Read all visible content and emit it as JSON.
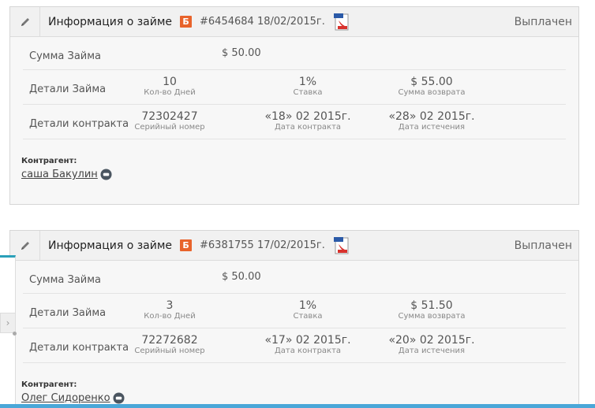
{
  "loans": [
    {
      "title": "Информация о займе",
      "badge": "Б",
      "ref": "#6454684 18/02/2015г.",
      "status": "Выплачен",
      "amount_label": "Сумма Займа",
      "amount": "$ 50.00",
      "details_label": "Детали Займа",
      "days": "10",
      "days_caption": "Кол-во Дней",
      "rate": "1%",
      "rate_caption": "Ставка",
      "repay": "$ 55.00",
      "repay_caption": "Сумма возврата",
      "contract_label": "Детали контракта",
      "serial": "72302427",
      "serial_caption": "Серийный номер",
      "contract_date": "«18» 02 2015г.",
      "contract_date_caption": "Дата контракта",
      "expiry": "«28» 02 2015г.",
      "expiry_caption": "Дата истечения",
      "counterparty_label": "Контрагент:",
      "counterparty": "саша Бакулин"
    },
    {
      "title": "Информация о займе",
      "badge": "Б",
      "ref": "#6381755 17/02/2015г.",
      "status": "Выплачен",
      "amount_label": "Сумма Займа",
      "amount": "$ 50.00",
      "details_label": "Детали Займа",
      "days": "3",
      "days_caption": "Кол-во Дней",
      "rate": "1%",
      "rate_caption": "Ставка",
      "repay": "$ 51.50",
      "repay_caption": "Сумма возврата",
      "contract_label": "Детали контракта",
      "serial": "72272682",
      "serial_caption": "Серийный номер",
      "contract_date": "«17» 02 2015г.",
      "contract_date_caption": "Дата контракта",
      "expiry": "«20» 02 2015г.",
      "expiry_caption": "Дата истечения",
      "counterparty_label": "Контрагент:",
      "counterparty": "Олег Сидоренко"
    }
  ],
  "icons": {
    "edit": "pencil-icon",
    "pdf": "pdf-file-icon",
    "counterparty": "chat-bubble-icon",
    "panel": "chevron-right-icon"
  },
  "colors": {
    "badge": "#e8632b",
    "accent": "#2aa0b9",
    "bottom_bar": "#4aa7d8"
  },
  "panel": {
    "chevron": "›"
  }
}
